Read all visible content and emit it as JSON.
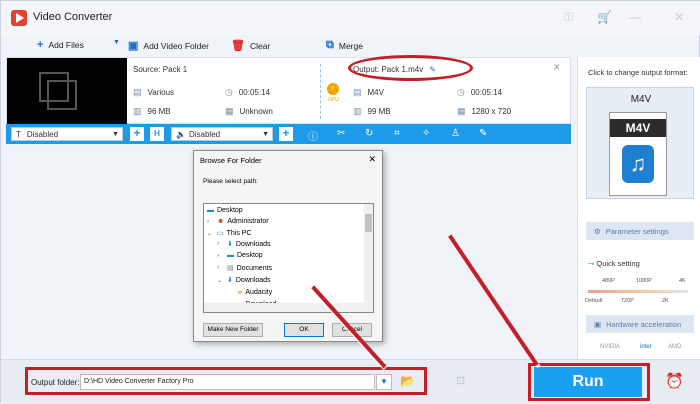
{
  "app": {
    "title": "Video Converter"
  },
  "toolbar": {
    "add_files": "Add Files",
    "add_video_folder": "Add Video Folder",
    "clear": "Clear",
    "merge": "Merge"
  },
  "file": {
    "source": "Source: Pack 1",
    "output": "Output: Pack 1.m4v",
    "src_format": "Various",
    "src_duration": "00:05:14",
    "src_size": "96 MB",
    "src_resolution": "Unknown",
    "out_format": "M4V",
    "out_duration": "00:05:14",
    "out_size": "99 MB",
    "out_resolution": "1280 x 720",
    "gpu_label": "GPU"
  },
  "editbar": {
    "subtitle_value": "Disabled",
    "audio_value": "Disabled"
  },
  "right_panel": {
    "hint": "Click to change output format:",
    "format_name": "M4V",
    "format_icon_text": "M4V",
    "parameter_settings": "Parameter settings",
    "quick_setting": "Quick setting",
    "q_480p": "480P",
    "q_1080p": "1080P",
    "q_4k": "4K",
    "q_default": "Default",
    "q_720p": "720P",
    "q_2k": "2K",
    "hardware_acceleration": "Hardware acceleration",
    "hw_nvidia": "NVIDIA",
    "hw_intel": "intel",
    "hw_amd": "AMD"
  },
  "bottom": {
    "output_folder_label": "Output folder:",
    "output_folder_value": "D:\\HD Video Converter Factory Pro",
    "run": "Run"
  },
  "dialog": {
    "title": "Browse For Folder",
    "prompt": "Please select path:",
    "tree": [
      {
        "label": "Desktop",
        "icon": "desktop-icon",
        "indent": 0,
        "chevron": ""
      },
      {
        "label": "Administrator",
        "icon": "user-icon",
        "indent": 1,
        "chevron": ">"
      },
      {
        "label": "This PC",
        "icon": "computer-icon",
        "indent": 1,
        "chevron": "v"
      },
      {
        "label": "Downloads",
        "icon": "download-icon",
        "indent": 2,
        "chevron": ">"
      },
      {
        "label": "Desktop",
        "icon": "desktop-icon",
        "indent": 2,
        "chevron": ">"
      },
      {
        "label": "Documents",
        "icon": "document-icon",
        "indent": 2,
        "chevron": ">"
      },
      {
        "label": "Downloads",
        "icon": "download-icon",
        "indent": 2,
        "chevron": "v"
      },
      {
        "label": "Audacity",
        "icon": "folder-icon",
        "indent": 3,
        "chevron": ""
      },
      {
        "label": "Download",
        "icon": "folder-icon",
        "indent": 3,
        "chevron": ""
      }
    ],
    "make_new_folder": "Make New Folder",
    "ok": "OK",
    "cancel": "Cancel"
  },
  "colors": {
    "accent": "#1e9be8",
    "run": "#1aa0f0",
    "annotation_red": "#c21f2a"
  }
}
